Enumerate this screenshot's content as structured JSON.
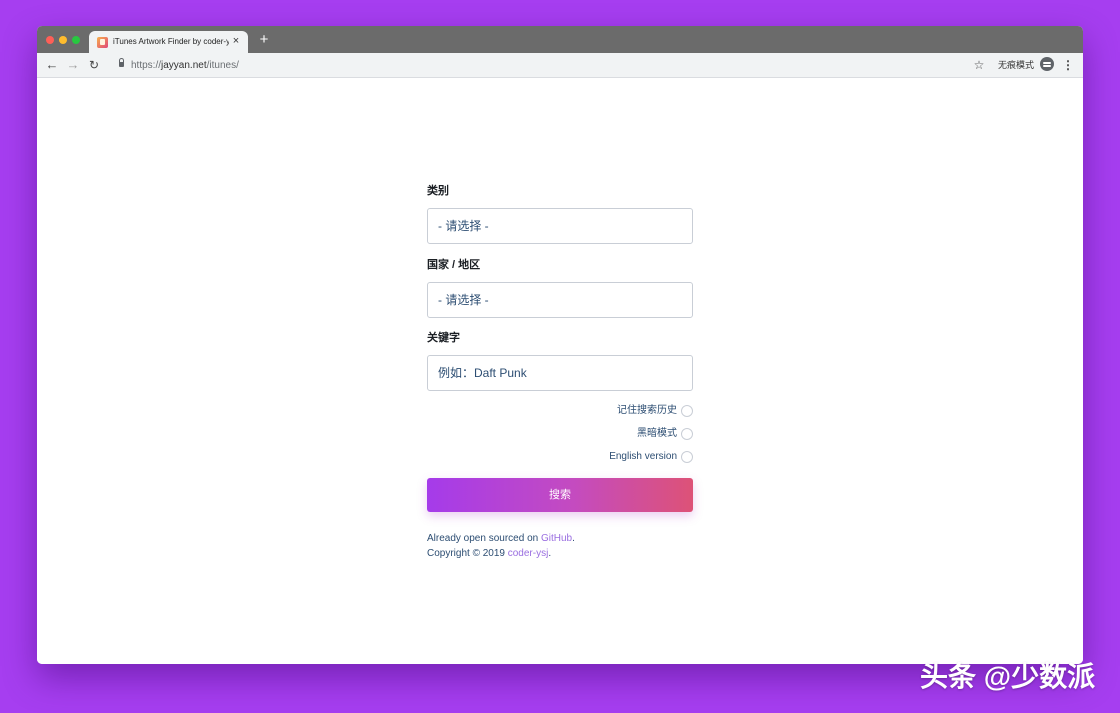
{
  "browser": {
    "tab_title": "iTunes Artwork Finder by coder-ysj",
    "tab_close": "×",
    "new_tab": "+",
    "url_scheme": "https://",
    "url_host": "jayyan.net",
    "url_path": "/itunes/",
    "incognito_label": "无痕模式",
    "nav_back": "←",
    "nav_forward": "→",
    "nav_reload": "↻",
    "bookmark_star": "☆",
    "menu": "⋮",
    "icons": [
      "back-arrow-icon",
      "forward-arrow-icon",
      "reload-icon",
      "lock-icon",
      "star-icon",
      "incognito-icon",
      "more-vert-icon",
      "favicon"
    ]
  },
  "form": {
    "category_label": "类别",
    "category_value": "- 请选择 -",
    "country_label": "国家 / 地区",
    "country_value": "- 请选择 -",
    "keyword_label": "关键字",
    "keyword_placeholder": "例如：Daft Punk",
    "options": [
      {
        "label": "记住搜索历史",
        "checked": false
      },
      {
        "label": "黑暗模式",
        "checked": false
      },
      {
        "label": "English version",
        "checked": false
      }
    ],
    "search_button": "搜索"
  },
  "footer": {
    "line1_prefix": "Already open sourced on ",
    "line1_link": "GitHub",
    "line1_suffix": ".",
    "line2_prefix": "Copyright © 2019 ",
    "line2_link": "coder-ysj",
    "line2_suffix": "."
  },
  "watermark": "头条 @少数派",
  "colors": {
    "background": "#a63ef0",
    "button_gradient_start": "#a53bea",
    "button_gradient_end": "#dd5277",
    "link": "#9a6ee0",
    "text": "#2c4d72"
  }
}
